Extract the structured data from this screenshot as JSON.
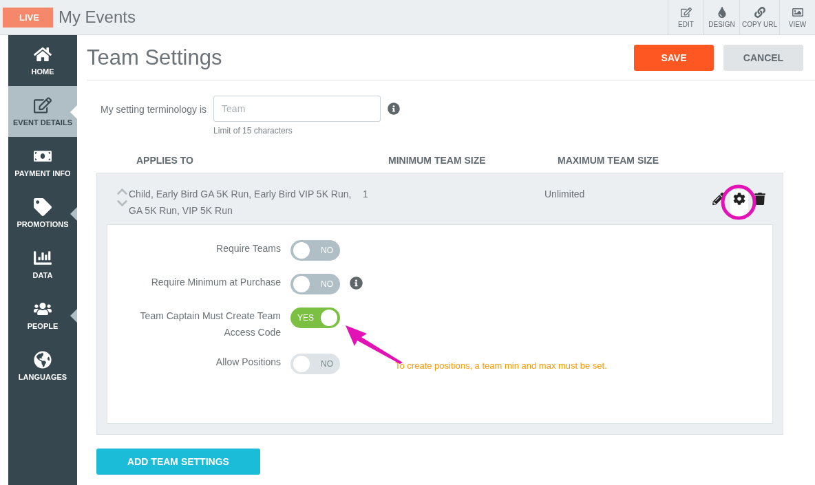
{
  "header": {
    "badge": "LIVE",
    "title": "My Events",
    "tools": [
      {
        "label": "EDIT"
      },
      {
        "label": "DESIGN"
      },
      {
        "label": "COPY URL"
      },
      {
        "label": "VIEW"
      }
    ]
  },
  "sidebar": {
    "items": [
      {
        "label": "HOME",
        "selected": false,
        "pointer": false
      },
      {
        "label": "EVENT DETAILS",
        "selected": true,
        "pointer": true
      },
      {
        "label": "PAYMENT INFO",
        "selected": false,
        "pointer": false
      },
      {
        "label": "PROMOTIONS",
        "selected": false,
        "pointer": true
      },
      {
        "label": "DATA",
        "selected": false,
        "pointer": false
      },
      {
        "label": "PEOPLE",
        "selected": false,
        "pointer": true
      },
      {
        "label": "LANGUAGES",
        "selected": false,
        "pointer": false
      }
    ]
  },
  "page": {
    "title": "Team Settings",
    "save": "SAVE",
    "cancel": "CANCEL"
  },
  "terminology": {
    "label": "My setting terminology is",
    "placeholder": "Team",
    "hint": "Limit of 15 characters"
  },
  "table": {
    "columns": [
      "APPLIES TO",
      "MINIMUM TEAM SIZE",
      "MAXIMUM TEAM SIZE"
    ],
    "rows": [
      {
        "applies_to": "Child, Early Bird GA 5K Run, Early Bird VIP 5K Run, GA 5K Run, VIP 5K Run",
        "minimum": "1",
        "maximum": "Unlimited",
        "expanded": true,
        "settings": [
          {
            "label": "Require Teams",
            "on": false,
            "disabled": false,
            "text": "NO"
          },
          {
            "label": "Require Minimum at Purchase",
            "on": false,
            "disabled": false,
            "info": true,
            "text": "NO"
          },
          {
            "label": "Team Captain Must Create Team Access Code",
            "on": true,
            "disabled": false,
            "text": "YES"
          },
          {
            "label": "Allow Positions",
            "on": false,
            "disabled": true,
            "text": "NO",
            "note": "To create positions, a team min and max must be set."
          }
        ]
      }
    ]
  },
  "add_button": "ADD TEAM SETTINGS"
}
